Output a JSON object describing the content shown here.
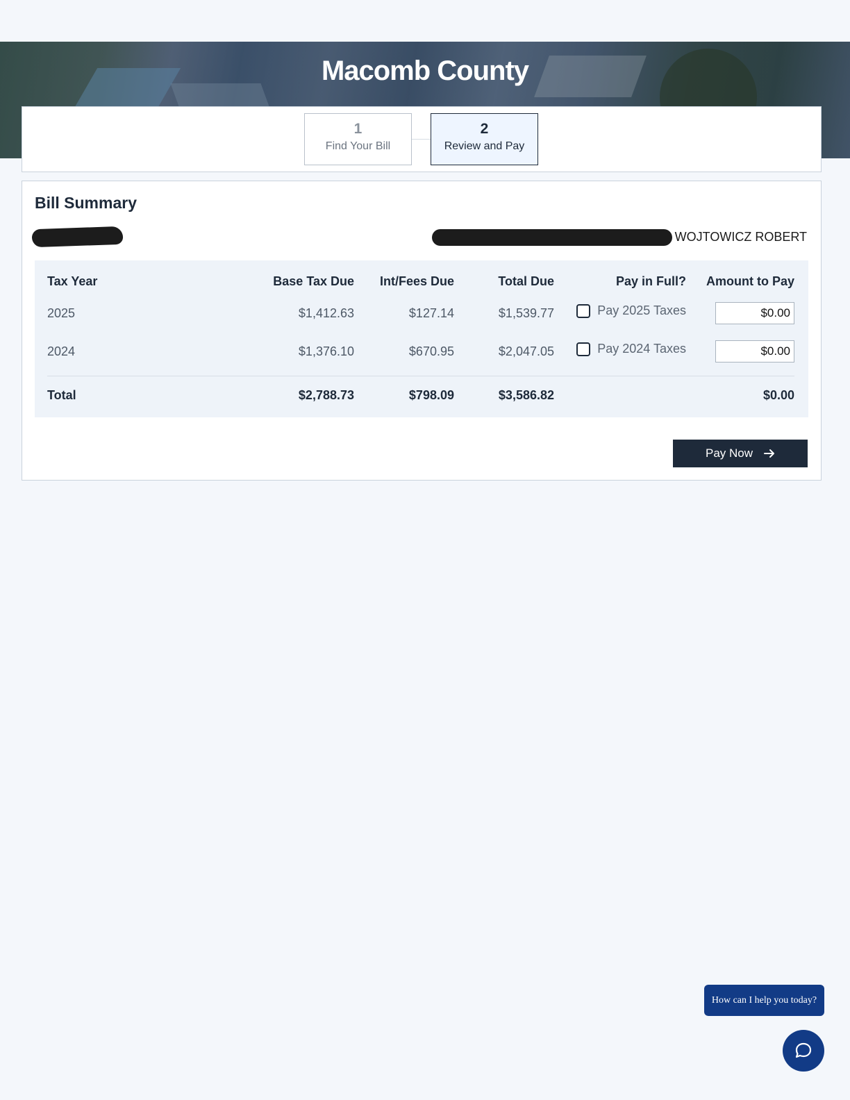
{
  "header": {
    "title": "Macomb County"
  },
  "steps": [
    {
      "number": "1",
      "label": "Find Your Bill",
      "active": false
    },
    {
      "number": "2",
      "label": "Review and Pay",
      "active": true
    }
  ],
  "summary": {
    "title": "Bill Summary",
    "owner_name": "WOJTOWICZ ROBERT",
    "columns": {
      "year": "Tax Year",
      "base": "Base Tax Due",
      "int": "Int/Fees Due",
      "total": "Total Due",
      "pay_in_full": "Pay in Full?",
      "amount": "Amount to Pay"
    },
    "rows": [
      {
        "year": "2025",
        "base": "$1,412.63",
        "int": "$127.14",
        "total": "$1,539.77",
        "pay_label": "Pay 2025 Taxes",
        "amount": "$0.00"
      },
      {
        "year": "2024",
        "base": "$1,376.10",
        "int": "$670.95",
        "total": "$2,047.05",
        "pay_label": "Pay 2024 Taxes",
        "amount": "$0.00"
      }
    ],
    "totals": {
      "label": "Total",
      "base": "$2,788.73",
      "int": "$798.09",
      "total": "$3,586.82",
      "amount": "$0.00"
    },
    "pay_button_label": "Pay Now",
    "pay_button_icon": "arrow-right-icon"
  },
  "chat": {
    "prompt": "How can I help you today?",
    "icon": "chat-bubble-icon"
  },
  "colors": {
    "primary": "#1e2a3a",
    "chat": "#123b86",
    "background": "#f4f7fb"
  }
}
